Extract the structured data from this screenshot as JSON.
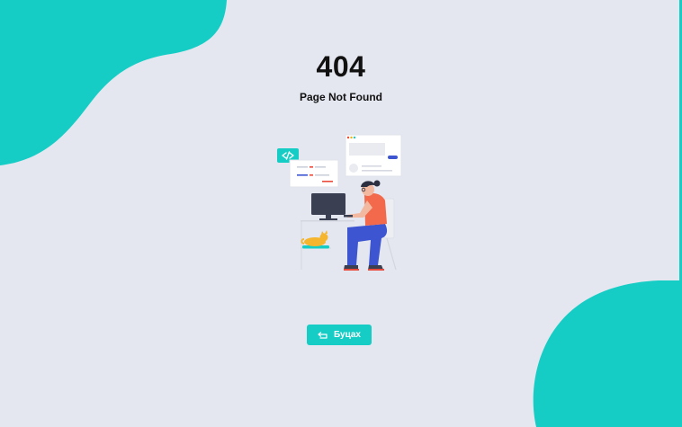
{
  "error": {
    "code": "404",
    "message": "Page Not Found"
  },
  "actions": {
    "back_label": "Буцах",
    "back_icon": "back-arrow-icon"
  },
  "colors": {
    "background": "#e4e7f0",
    "accent": "#15cdc5",
    "text": "#111111"
  }
}
